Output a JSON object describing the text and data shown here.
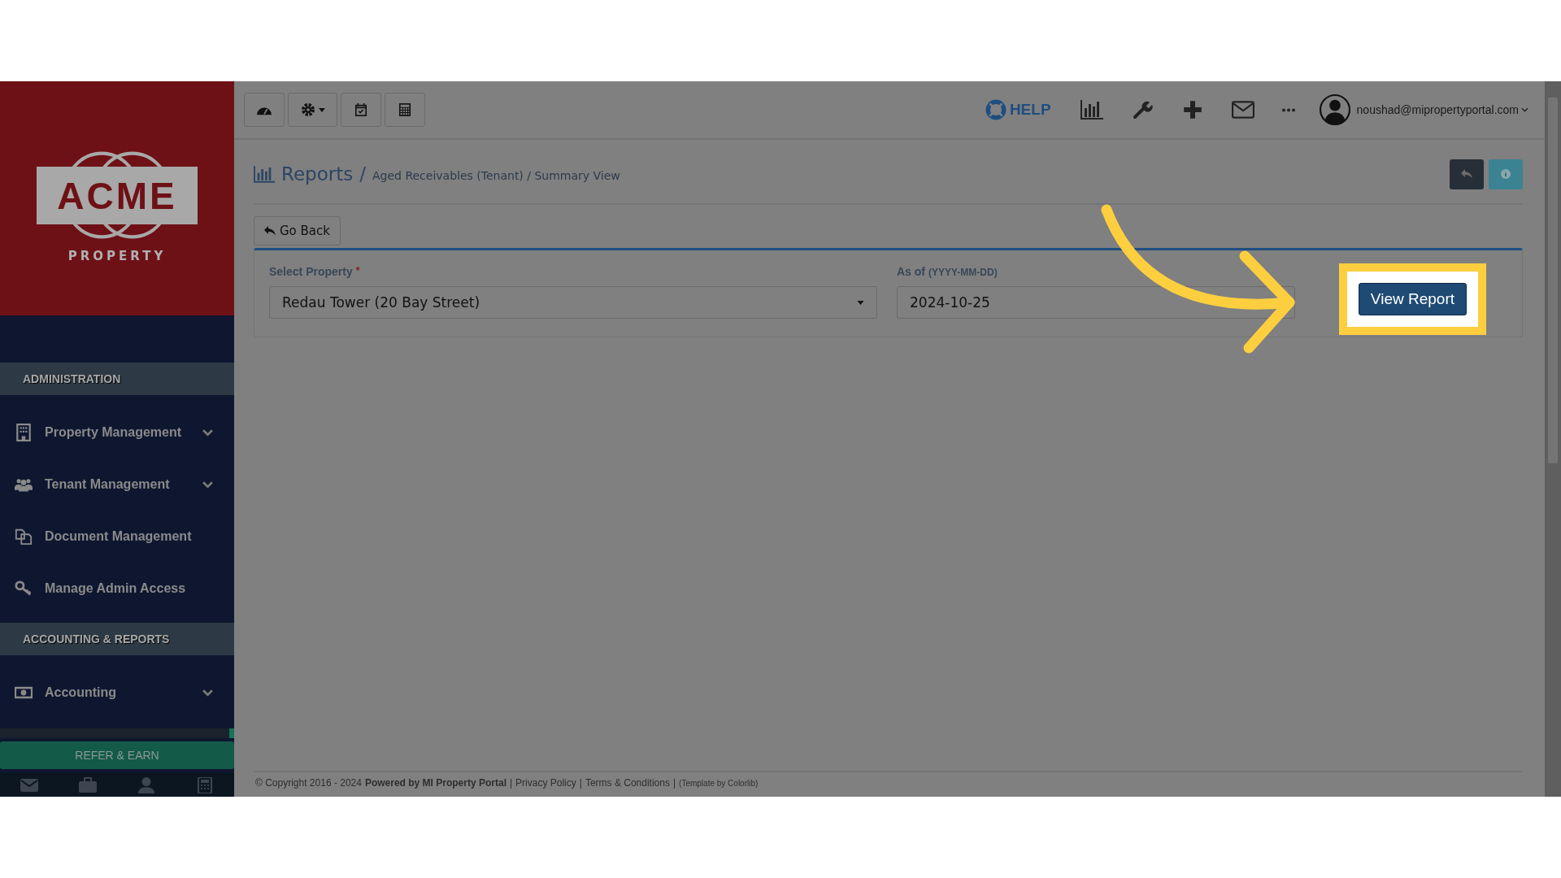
{
  "brand": {
    "name": "ACME",
    "tagline": "PROPERTY"
  },
  "toolbar": {
    "help": "HELP",
    "user": "noushad@mipropertyportal.com"
  },
  "sidebar": {
    "sections": [
      {
        "title": "ADMINISTRATION",
        "items": [
          {
            "label": "Property Management",
            "expandable": true
          },
          {
            "label": "Tenant Management",
            "expandable": true
          },
          {
            "label": "Document Management",
            "expandable": false
          },
          {
            "label": "Manage Admin Access",
            "expandable": false
          }
        ]
      },
      {
        "title": "ACCOUNTING & REPORTS",
        "items": [
          {
            "label": "Accounting",
            "expandable": true
          }
        ]
      }
    ],
    "refer_button": "REFER & EARN"
  },
  "breadcrumb": {
    "title": "Reports",
    "separator": "/",
    "path": "Aged Receivables (Tenant) / Summary View"
  },
  "go_back": "Go Back",
  "form": {
    "property_label": "Select Property",
    "required_mark": "*",
    "property_value": "Redau Tower (20 Bay Street)",
    "date_label": "As of",
    "date_hint": "(YYYY-MM-DD)",
    "date_value": "2024-10-25",
    "submit": "View Report"
  },
  "footer": {
    "copyright": "© Copyright 2016 - 2024",
    "powered": "Powered by MI Property Portal",
    "sep": "|",
    "privacy": "Privacy Policy",
    "terms": "Terms & Conditions",
    "template": "(Template by Colorlib)"
  }
}
